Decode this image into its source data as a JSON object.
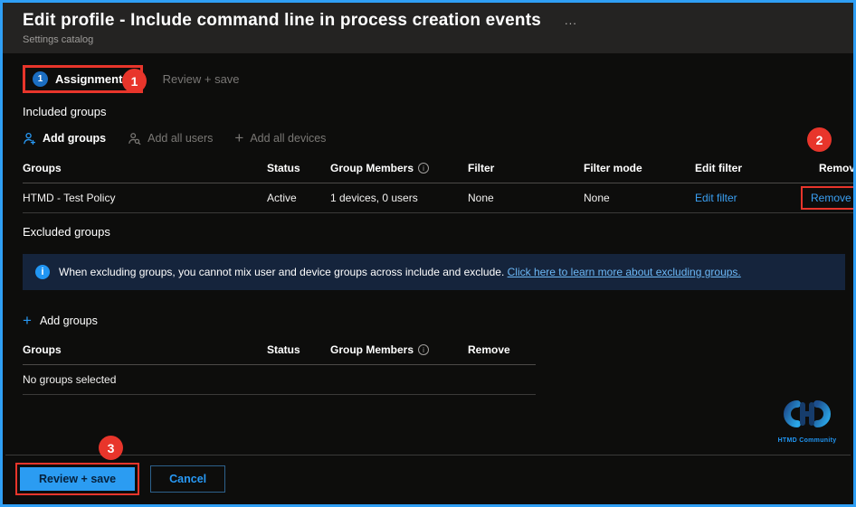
{
  "header": {
    "title": "Edit profile - Include command line in process creation events",
    "ellipsis": "...",
    "subtitle": "Settings catalog"
  },
  "tabs": {
    "assignments": {
      "step": "1",
      "label": "Assignments"
    },
    "review_save": {
      "label": "Review + save"
    }
  },
  "annotations": {
    "badge1": "1",
    "badge2": "2",
    "badge3": "3"
  },
  "included": {
    "heading": "Included groups",
    "actions": [
      {
        "label": "Add groups",
        "icon": "person-add-icon",
        "enabled": true
      },
      {
        "label": "Add all users",
        "icon": "person-search-icon",
        "enabled": false
      },
      {
        "label": "Add all devices",
        "icon": "plus-icon",
        "enabled": false
      }
    ],
    "table": {
      "headers": [
        "Groups",
        "Status",
        "Group Members",
        "Filter",
        "Filter mode",
        "Edit filter",
        "Remove"
      ],
      "rows": [
        {
          "group": "HTMD - Test Policy",
          "status": "Active",
          "members": "1 devices, 0 users",
          "filter": "None",
          "filter_mode": "None",
          "edit_filter": "Edit filter",
          "remove": "Remove"
        }
      ]
    }
  },
  "excluded": {
    "heading": "Excluded groups",
    "banner": {
      "text": "When excluding groups, you cannot mix user and device groups across include and exclude. ",
      "link": "Click here to learn more about excluding groups."
    },
    "add_groups_label": "Add groups",
    "table": {
      "headers": [
        "Groups",
        "Status",
        "Group Members",
        "Remove"
      ],
      "empty_text": "No groups selected"
    }
  },
  "footer": {
    "review_save": "Review + save",
    "cancel": "Cancel"
  },
  "logo": {
    "text": "HTMD Community"
  },
  "colors": {
    "frame_border": "#2f9ff5",
    "accent_blue": "#2899f5",
    "annotation_red": "#e8352b",
    "banner_bg": "#15243c",
    "titlebar_bg": "#242322",
    "body_bg": "#0d0d0c"
  }
}
